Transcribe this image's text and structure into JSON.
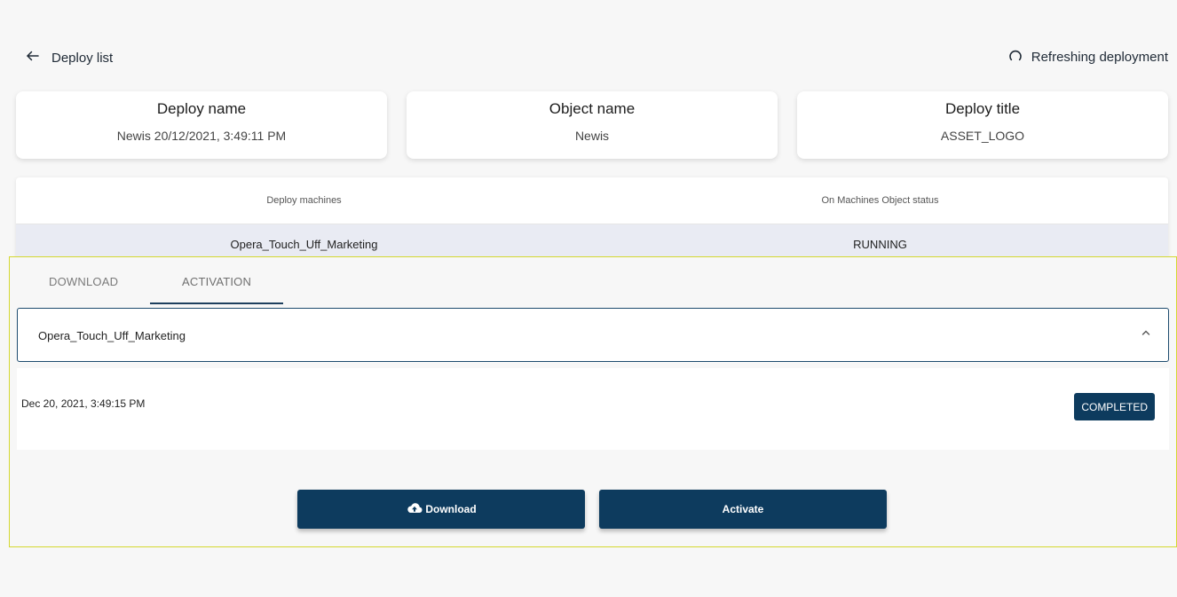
{
  "nav": {
    "back_label": "Deploy list",
    "refresh_label": "Refreshing deployment"
  },
  "cards": [
    {
      "title": "Deploy name",
      "value": "Newis 20/12/2021, 3:49:11 PM"
    },
    {
      "title": "Object name",
      "value": "Newis"
    },
    {
      "title": "Deploy title",
      "value": "ASSET_LOGO"
    }
  ],
  "machines": {
    "headers": [
      "Deploy machines",
      "On Machines Object status"
    ],
    "rows": [
      [
        "Opera_Touch_Uff_Marketing",
        "RUNNING"
      ]
    ]
  },
  "tabs": [
    {
      "label": "DOWNLOAD",
      "active": false
    },
    {
      "label": "ACTIVATION",
      "active": true
    }
  ],
  "accordion": {
    "label": "Opera_Touch_Uff_Marketing",
    "expanded": true
  },
  "detail": {
    "date": "Dec 20, 2021, 3:49:15 PM",
    "status": "COMPLETED"
  },
  "actions": {
    "download_label": "Download",
    "activate_label": "Activate"
  },
  "colors": {
    "primary": "#0d3b5e",
    "highlight_border": "#d4d830",
    "row_highlight": "#e9ebf3"
  }
}
